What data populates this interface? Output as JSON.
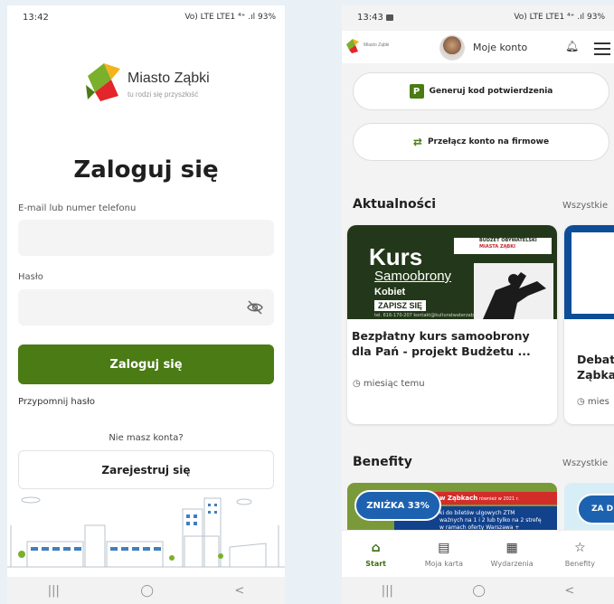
{
  "phone_login": {
    "status": {
      "time": "13:42",
      "right": "Vo) LTE LTE1 ⁴⁺ .ıl 93%"
    },
    "logo": {
      "name_part1": "M",
      "name_part2": "iasto ",
      "name_part3": "Ząbki",
      "tagline": "tu rodzi się przyszłość"
    },
    "title": "Zaloguj się",
    "email_label": "E-mail lub numer telefonu",
    "email_value": "",
    "password_label": "Hasło",
    "password_value": "",
    "login_button": "Zaloguj się",
    "forgot_link": "Przypomnij hasło",
    "no_account_text": "Nie masz konta?",
    "register_button": "Zarejestruj się",
    "nav": {
      "recent": "|||",
      "home": "◯",
      "back": "<"
    }
  },
  "phone_app": {
    "status": {
      "time": "13:43",
      "right": "Vo) LTE LTE1 ⁴⁺ .ıl 93%"
    },
    "header": {
      "logo_text": "Miasto Ząbki",
      "account_label": "Moje konto"
    },
    "generate_code_badge": "P",
    "generate_code_label": "Generuj kod potwierdzenia",
    "switch_icon": "⇄",
    "switch_account_label": "Przełącz konto na firmowe",
    "news": {
      "section_title": "Aktualności",
      "see_all": "Wszystkie",
      "card1": {
        "img_kurs": "Kurs",
        "img_samoobrony": "Samoobrony",
        "img_kobiet": "Kobiet",
        "img_zapisz": "ZAPISZ SIĘ",
        "img_tel": "tel. 616-170-207  kontakt@kulturatwaterzabki.pl",
        "img_banner_line1": "BUDŻET OBYWATELSKI",
        "img_banner_line2": "MIASTA ZĄBKI",
        "title": "Bezpłatny kurs samoobrony dla Pań - projekt Budżetu ...",
        "time": "miesiąc temu"
      },
      "card2": {
        "title_line1": "Debat",
        "title_line2": "Ząbka",
        "time": "mies"
      }
    },
    "benefits": {
      "section_title": "Benefity",
      "see_all": "Wszystkie",
      "card1": {
        "badge": "ZNIŻKA 33%",
        "red_text": "w Ząbkach",
        "red_small": " również w 2021 r.",
        "blue_line1": "ki do biletów ulgowych ZTM",
        "blue_line2": "ważnych na 1 i 2 lub tylko na 2 strefę",
        "blue_line3": "w ramach oferty Warszawa +"
      },
      "card2": {
        "badge": "ZA D"
      }
    },
    "tabs": [
      {
        "icon": "⌂",
        "label": "Start"
      },
      {
        "icon": "▤",
        "label": "Moja karta"
      },
      {
        "icon": "▦",
        "label": "Wydarzenia"
      },
      {
        "icon": "☆",
        "label": "Benefity"
      }
    ],
    "nav": {
      "recent": "|||",
      "home": "◯",
      "back": "<"
    }
  },
  "colors": {
    "primary_green": "#4a7b14",
    "tab_active": "#3d6e0e",
    "background": "#e9f1f6"
  }
}
